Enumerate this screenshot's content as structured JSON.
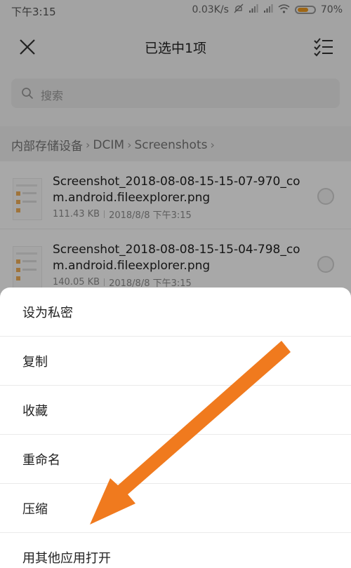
{
  "status_bar": {
    "time": "下午3:15",
    "network_speed": "0.03K/s",
    "battery": "70%",
    "icons": [
      "mute-icon",
      "signal-icon",
      "signal-icon",
      "wifi-icon",
      "battery-icon"
    ],
    "battery_level": 0.7
  },
  "header": {
    "title": "已选中1项",
    "close_icon": "close-icon",
    "select_all_icon": "select-all-icon"
  },
  "search": {
    "placeholder": "搜索",
    "icon": "search-icon"
  },
  "breadcrumb": {
    "items": [
      "内部存储设备",
      "DCIM",
      "Screenshots"
    ]
  },
  "files": [
    {
      "name": "Screenshot_2018-08-08-15-15-07-970_com.android.fileexplorer.png",
      "size": "111.43 KB",
      "date": "2018/8/8 下午3:15"
    },
    {
      "name": "Screenshot_2018-08-08-15-15-04-798_com.android.fileexplorer.png",
      "size": "140.05 KB",
      "date": "2018/8/8 下午3:15"
    }
  ],
  "action_sheet": {
    "items": [
      "设为私密",
      "复制",
      "收藏",
      "重命名",
      "压缩",
      "用其他应用打开"
    ]
  },
  "colors": {
    "accent_arrow": "#f07a1e",
    "battery": "#f09b20"
  }
}
